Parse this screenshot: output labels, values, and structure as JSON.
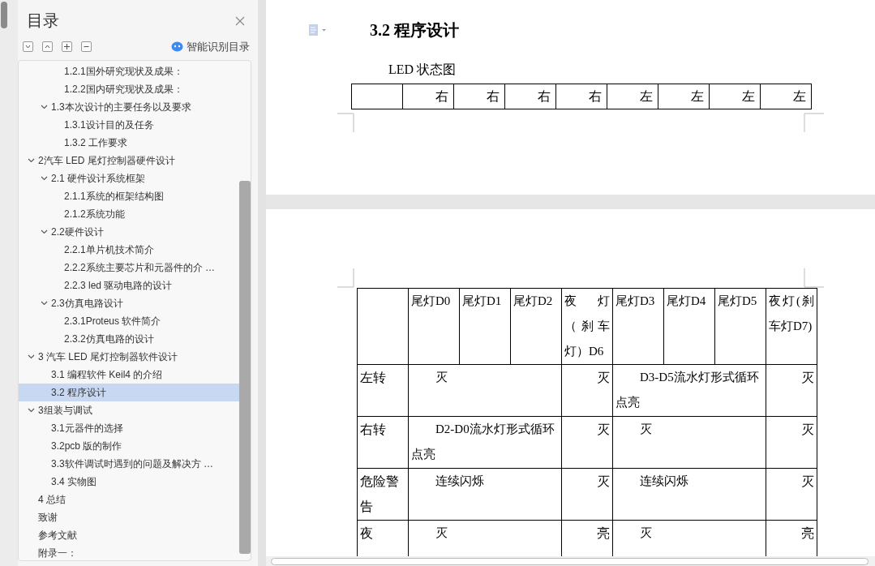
{
  "sidebar": {
    "title": "目录",
    "smart_toc": "智能识别目录",
    "items": [
      {
        "children": [
          {
            "children": [
              {
                "label": "1.2.1国外研究现状及成果：",
                "selected": false
              },
              {
                "label": "1.2.2国内研究现状及成果：",
                "selected": false
              }
            ]
          },
          {
            "label": "1.3本次设计的主要任务以及要求",
            "selected": false,
            "expanded": true,
            "children": [
              {
                "label": "1.3.1设计目的及任务",
                "selected": false
              },
              {
                "label": "1.3.2 工作要求",
                "selected": false
              }
            ]
          }
        ]
      },
      {
        "label": "2汽车 LED 尾灯控制器硬件设计",
        "selected": false,
        "expanded": true,
        "children": [
          {
            "label": "2.1 硬件设计系统框架",
            "selected": false,
            "expanded": true,
            "children": [
              {
                "label": "2.1.1系统的框架结构图",
                "selected": false
              },
              {
                "label": "2.1.2系统功能",
                "selected": false
              }
            ]
          },
          {
            "label": "2.2硬件设计",
            "selected": false,
            "expanded": true,
            "children": [
              {
                "label": "2.2.1单片机技术简介",
                "selected": false
              },
              {
                "label": "2.2.2系统主要芯片和元器件的介 …",
                "selected": false
              },
              {
                "label": "2.2.3 led 驱动电路的设计",
                "selected": false
              }
            ]
          },
          {
            "label": "2.3仿真电路设计",
            "selected": false,
            "expanded": true,
            "children": [
              {
                "label": "2.3.1Proteus 软件简介",
                "selected": false
              },
              {
                "label": "2.3.2仿真电路的设计",
                "selected": false
              }
            ]
          }
        ]
      },
      {
        "label": "3 汽车 LED 尾灯控制器软件设计",
        "selected": false,
        "expanded": true,
        "children": [
          {
            "label": "3.1 编程软件 Keil4 的介绍",
            "selected": false
          },
          {
            "label": "3.2 程序设计",
            "selected": true
          }
        ]
      },
      {
        "label": "3组装与调试",
        "selected": false,
        "expanded": true,
        "children": [
          {
            "label": "3.1元器件的选择",
            "selected": false
          },
          {
            "label": "3.2pcb 版的制作",
            "selected": false
          },
          {
            "label": "3.3软件调试时遇到的问题及解决方 …",
            "selected": false
          },
          {
            "label": "3.4 实物图",
            "selected": false
          }
        ]
      },
      {
        "label": "4 总结",
        "selected": false
      },
      {
        "label": "致谢",
        "selected": false
      },
      {
        "label": "参考文献",
        "selected": false
      },
      {
        "label": "附录一：",
        "selected": false
      }
    ]
  },
  "document": {
    "heading": "3.2 程序设计",
    "caption": "LED 状态图",
    "table_1": {
      "cells": [
        "右",
        "右",
        "右",
        "右",
        "左",
        "左",
        "左",
        "左"
      ]
    },
    "table_2": {
      "header": [
        "尾灯D0",
        "尾灯D1",
        "尾灯D2",
        "夜灯（刹车灯）D6",
        "尾灯D3",
        "尾灯D4",
        "尾灯D5",
        "夜灯(刹车灯D7)"
      ],
      "rows": [
        {
          "cells": [
            {
              "text": "左转",
              "kind": "single"
            },
            {
              "text": "灭",
              "kind": "merged"
            },
            {
              "text": "灭",
              "kind": "single"
            },
            {
              "text": "D3-D5流水灯形式循环点亮",
              "kind": "merged"
            },
            {
              "text": "灭",
              "kind": "single"
            }
          ]
        },
        {
          "cells": [
            {
              "text": "右转",
              "kind": "single"
            },
            {
              "text": "D2-D0流水灯形式循环点亮",
              "kind": "merged"
            },
            {
              "text": "灭",
              "kind": "single"
            },
            {
              "text": "灭",
              "kind": "merged"
            },
            {
              "text": "灭",
              "kind": "single"
            }
          ]
        },
        {
          "cells": [
            {
              "text": "危险警告",
              "kind": "single"
            },
            {
              "text": "连续闪烁",
              "kind": "merged"
            },
            {
              "text": "灭",
              "kind": "single"
            },
            {
              "text": "连续闪烁",
              "kind": "merged"
            },
            {
              "text": "灭",
              "kind": "single"
            }
          ]
        },
        {
          "cells": [
            {
              "text": "夜",
              "kind": "single"
            },
            {
              "text": "灭",
              "kind": "merged"
            },
            {
              "text": "亮",
              "kind": "single"
            },
            {
              "text": "灭",
              "kind": "merged"
            },
            {
              "text": "亮",
              "kind": "single"
            }
          ]
        }
      ]
    }
  }
}
